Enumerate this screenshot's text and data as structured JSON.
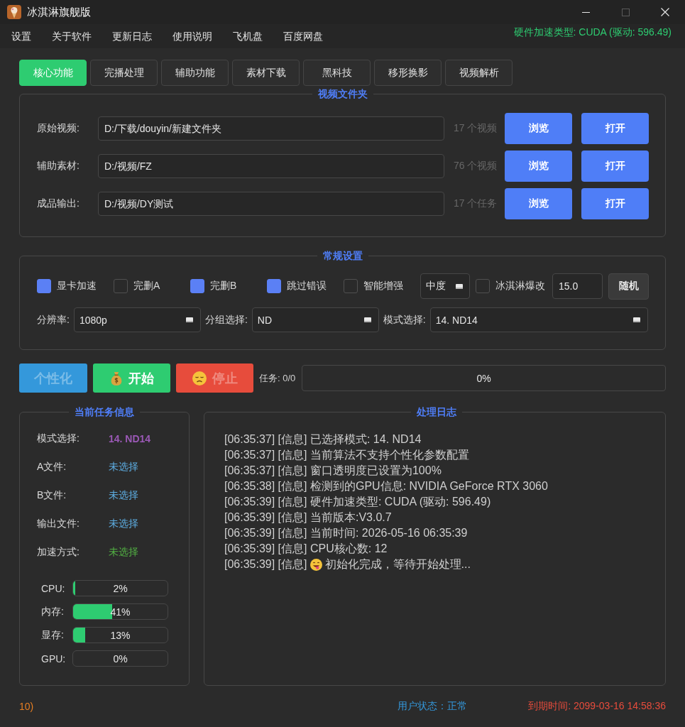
{
  "window": {
    "title": "冰淇淋旗舰版",
    "maximize_disabled": true
  },
  "menu": {
    "items": [
      "设置",
      "关于软件",
      "更新日志",
      "使用说明",
      "飞机盘",
      "百度网盘"
    ],
    "hardware_status": "硬件加速类型: CUDA (驱动: 596.49)"
  },
  "tabs": [
    {
      "label": "核心功能",
      "selected": true
    },
    {
      "label": "完播处理",
      "selected": false
    },
    {
      "label": "辅助功能",
      "selected": false
    },
    {
      "label": "素材下载",
      "selected": false
    },
    {
      "label": "黑科技",
      "selected": false
    },
    {
      "label": "移形换影",
      "selected": false
    },
    {
      "label": "视频解析",
      "selected": false
    }
  ],
  "folders": {
    "title": "视频文件夹",
    "rows": [
      {
        "label": "原始视频:",
        "path": "D:/下载/douyin/新建文件夹",
        "count": "17 个视频",
        "browse": "浏览",
        "open": "打开"
      },
      {
        "label": "辅助素材:",
        "path": "D:/视频/FZ",
        "count": "76 个视频",
        "browse": "浏览",
        "open": "打开"
      },
      {
        "label": "成品输出:",
        "path": "D:/视频/DY测试",
        "count": "17 个任务",
        "browse": "浏览",
        "open": "打开"
      }
    ]
  },
  "settings": {
    "title": "常规设置",
    "options": [
      {
        "kind": "checkbox",
        "label": "显卡加速",
        "checked": true
      },
      {
        "kind": "checkbox",
        "label": "完删A",
        "checked": false
      },
      {
        "kind": "checkbox",
        "label": "完删B",
        "checked": true
      },
      {
        "kind": "checkbox",
        "label": "跳过错误",
        "checked": true
      },
      {
        "kind": "checkbox",
        "label": "智能增强",
        "checked": false
      },
      {
        "kind": "dropdown",
        "value": "中度"
      },
      {
        "kind": "checkbox",
        "label": "冰淇淋爆改",
        "checked": false
      },
      {
        "kind": "input",
        "value": "15.0"
      },
      {
        "kind": "button",
        "label": "随机"
      }
    ],
    "selects": [
      {
        "label": "分辨率:",
        "value": "1080p"
      },
      {
        "label": "分组选择:",
        "value": "ND"
      },
      {
        "label": "模式选择:",
        "value": "14. ND14"
      }
    ]
  },
  "actions": {
    "buttons": [
      {
        "kind": "personalize",
        "label": "个性化",
        "disabled": true
      },
      {
        "kind": "start",
        "label": "开始",
        "disabled": false
      },
      {
        "kind": "stop",
        "label": "停止",
        "disabled": true
      }
    ],
    "task": "任务: 0/0",
    "progress": {
      "level": 0,
      "reading": "0%"
    }
  },
  "task_info": {
    "title": "当前任务信息",
    "fields": [
      {
        "label": "模式选择:",
        "value": "14. ND14",
        "color": "#9b59b6"
      },
      {
        "label": "A文件:",
        "value": "未选择",
        "color": "#5dade2"
      },
      {
        "label": "B文件:",
        "value": "未选择",
        "color": "#5dade2"
      },
      {
        "label": "输出文件:",
        "value": "未选择",
        "color": "#5dade2"
      },
      {
        "label": "加速方式:",
        "value": "未选择",
        "color": "#52b043"
      }
    ],
    "meters": [
      {
        "label": "CPU:",
        "level": 0.02,
        "reading": "2%"
      },
      {
        "label": "内存:",
        "level": 0.41,
        "reading": "41%"
      },
      {
        "label": "显存:",
        "level": 0.13,
        "reading": "13%"
      },
      {
        "label": "GPU:",
        "level": 0,
        "reading": "0%"
      }
    ]
  },
  "log": {
    "title": "处理日志",
    "lines": [
      {
        "kind": "text",
        "text": "[06:35:37] [信息] 已选择模式: 14. ND14"
      },
      {
        "kind": "text",
        "text": "[06:35:37] [信息] 当前算法不支持个性化参数配置"
      },
      {
        "kind": "text",
        "text": "[06:35:37] [信息] 窗口透明度已设置为100%"
      },
      {
        "kind": "text",
        "text": "[06:35:38] [信息] 检测到的GPU信息: NVIDIA GeForce RTX 3060"
      },
      {
        "kind": "text",
        "text": "[06:35:39] [信息] 硬件加速类型: CUDA (驱动: 596.49)"
      },
      {
        "kind": "text",
        "text": "[06:35:39] [信息] 当前版本:V3.0.7"
      },
      {
        "kind": "text",
        "text": "[06:35:39] [信息] 当前时间: 2026-05-16 06:35:39"
      },
      {
        "kind": "text",
        "text": "[06:35:39] [信息] CPU核心数: 12"
      },
      {
        "kind": "emoji",
        "prefix": "[06:35:39] [信息]",
        "message": "初始化完成，等待开始处理..."
      }
    ]
  },
  "status_bar": {
    "left": "10)",
    "user_status": "用户状态：正常",
    "expiry": "到期时间: 2099-03-16 14:58:36"
  }
}
